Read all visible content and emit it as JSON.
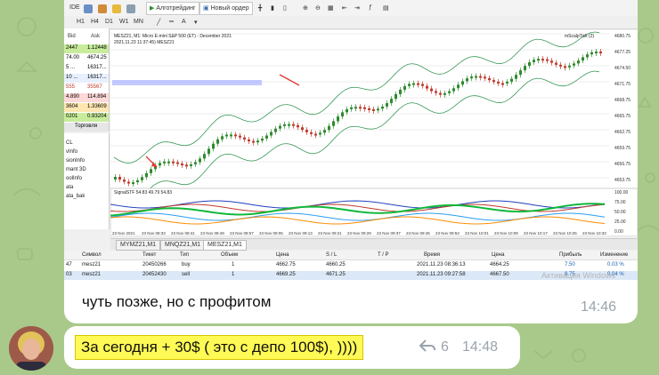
{
  "toolbar": {
    "ide_label": "IDE",
    "algo_label": "Алготрейдинг",
    "new_order_label": "Новый ордер",
    "timeframes": [
      "H1",
      "H4",
      "D1",
      "W1",
      "MN"
    ]
  },
  "watchlist": {
    "headers": [
      "Bid",
      "Ask"
    ],
    "rows": [
      {
        "bid": "2447",
        "ask": "1.12448",
        "bg": "#c8ec9c"
      },
      {
        "bid": "74.00",
        "ask": "4674.25",
        "bg": "#ffffff"
      },
      {
        "bid": "5 ...",
        "ask": "16317...",
        "bg": "#ffffff"
      },
      {
        "bid": "10 ...",
        "ask": "16317...",
        "bg": "#e8f0ff"
      },
      {
        "bid": "555",
        "ask": "35567",
        "bg": "#ffffff"
      },
      {
        "bid": "4.890",
        "ask": "114.894",
        "bg": "#ffd8d8"
      },
      {
        "bid": "3604",
        "ask": "1.33609",
        "bg": "#ffe6b0"
      },
      {
        "bid": "0201",
        "ask": "0.93204",
        "bg": "#c8ec9c"
      }
    ],
    "nav_tabs": [
      "Торговля"
    ]
  },
  "navigator": {
    "items": [
      "CL",
      "vInfo",
      "sionInfo",
      "mant 3D",
      "oolInfo",
      "ata",
      "ata_bak"
    ]
  },
  "chart": {
    "title_line": "MESZ21, M1: Micro E-mini S&P 500 (ET) - December 2021",
    "sub_line": "2021.11.23 11:37:45) MESZ21",
    "right_label": "mScalpTick (2)",
    "indicator_label": "SignalSTF 54.83 49.79 54.83",
    "price_ticks": [
      "4680.75",
      "4677.25",
      "4674.50",
      "4671.75",
      "4668.75",
      "4665.75",
      "4662.75",
      "4659.75",
      "4656.75",
      "4653.75"
    ],
    "ind_ticks": [
      "100.00",
      "75.00",
      "50.00",
      "25.00",
      "0.00"
    ],
    "time_ticks": [
      "23 Nov 2021",
      "23 Nov 08:33",
      "23 Nov 08:41",
      "23 Nov 08:49",
      "23 Nov 08:57",
      "23 Nov 09:05",
      "23 Nov 09:13",
      "23 Nov 09:21",
      "23 Nov 09:29",
      "23 Nov 09:37",
      "23 Nov 09:45",
      "23 Nov 09:53",
      "23 Nov 10:01",
      "23 Nov 10:09",
      "23 Nov 10:17",
      "23 Nov 10:25",
      "23 Nov 10:33"
    ],
    "tabs": [
      "MYMZ21,M1",
      "MNQZ21,M1",
      "MESZ21,M1"
    ],
    "active_tab": 2
  },
  "trades": {
    "headers": [
      "Символ",
      "Тикет",
      "Тип",
      "Объем",
      "Цена",
      "S / L",
      "T / P",
      "Время",
      "Цена",
      "Прибыль",
      "Изменение"
    ],
    "rows": [
      {
        "prefix": "47",
        "symbol": "mesz21",
        "ticket": "20450266",
        "type": "buy",
        "volume": "1",
        "price": "4662.75",
        "sl": "4660.25",
        "tp": "",
        "time": "2021.11.23 08:36:13",
        "cur": "4664.25",
        "profit": "7.50",
        "change": "0.03 %"
      },
      {
        "prefix": "03",
        "symbol": "mesz21",
        "ticket": "20452430",
        "type": "sell",
        "volume": "1",
        "price": "4669.25",
        "sl": "4671.25",
        "tp": "",
        "time": "2021.11.23 09:27:58",
        "cur": "4667.50",
        "profit": "8.75",
        "change": "0.04 %"
      }
    ],
    "watermark": "Активация Windows"
  },
  "messages": {
    "first_text": "чуть позже, но с профитом",
    "first_time": "14:46",
    "second_text": "За сегодня + 30$  ( это с депо 100$), ))))",
    "second_views": "6",
    "second_time": "14:48"
  },
  "colors": {
    "chat_bg": "#a9c98a",
    "bull": "#2e8b2e",
    "bear": "#c0392b",
    "highlight": "#fffa55"
  }
}
